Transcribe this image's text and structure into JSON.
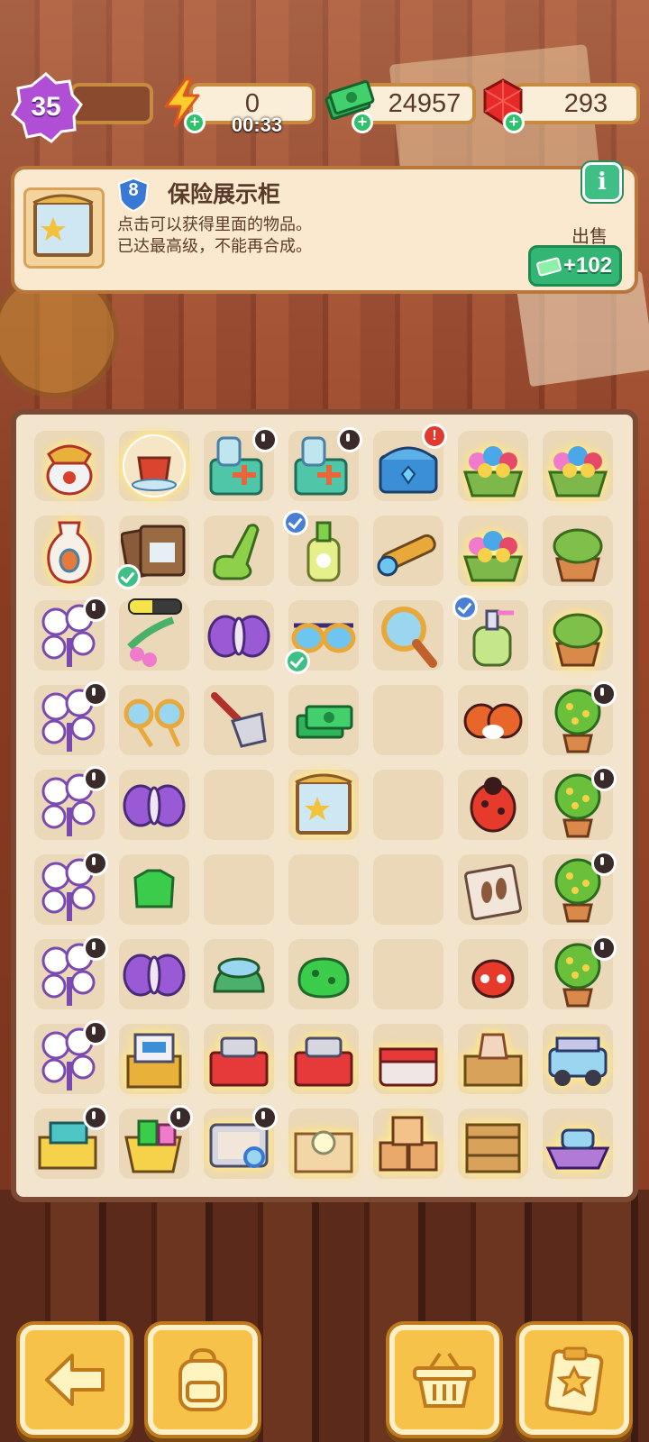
{
  "hud": {
    "level": "35",
    "energy": "0",
    "energy_timer": "00:33",
    "cash": "24957",
    "gems": "293"
  },
  "info_panel": {
    "item_level": "8",
    "item_name": "保险展示柜",
    "description_line1": "点击可以获得里面的物品。",
    "description_line2": "已达最高级，不能再合成。",
    "info_button": "i",
    "sell_label": "出售",
    "sell_value": "+102"
  },
  "board": {
    "energy_progress": 0.45,
    "rows": [
      [
        "dragon-vase",
        "tea-cup-bubble",
        "first-aid-kit",
        "first-aid-kit",
        "treasure-chest",
        "flower-basket",
        "flower-basket"
      ],
      [
        "porcelain-vase",
        "photo-envelope",
        "green-slipper",
        "lotion-bottle",
        "spyglass",
        "flower-basket",
        "potted-plant"
      ],
      [
        "cotton-tree",
        "frog-toy",
        "purple-moth",
        "sunglasses",
        "magnifier",
        "lotion-pump",
        "potted-plant"
      ],
      [
        "cotton-tree",
        "orange-glasses",
        "garden-rake",
        "cash-bundle",
        "empty",
        "ladybug-pair",
        "orange-tree"
      ],
      [
        "cotton-tree",
        "purple-moth",
        "empty",
        "display-cabinet",
        "empty",
        "ladybug",
        "orange-tree"
      ],
      [
        "cotton-tree",
        "green-shirt",
        "empty",
        "empty",
        "empty",
        "footprint-bag",
        "orange-tree"
      ],
      [
        "cotton-tree",
        "purple-moth",
        "green-hat",
        "green-sponge",
        "empty",
        "red-ladybug",
        "orange-tree"
      ],
      [
        "cotton-tree",
        "toolbox-crate",
        "red-toolbox",
        "red-toolbox",
        "red-cooler",
        "clay-pots-crate",
        "jeep"
      ],
      [
        "sewing-box",
        "laundry-basket",
        "evidence-kit",
        "lightbulb-box",
        "boxes-pile",
        "crate-stack",
        "boat"
      ]
    ]
  },
  "colors": {
    "accent_green": "#33b674",
    "panel_bg": "#fbe9cf",
    "button_yellow": "#f7c24a",
    "level_purple": "#b04fd6"
  },
  "bottom_bar": {
    "buttons": [
      "back-arrow-icon",
      "backpack-icon",
      "basket-icon",
      "clipboard-star-icon"
    ]
  }
}
